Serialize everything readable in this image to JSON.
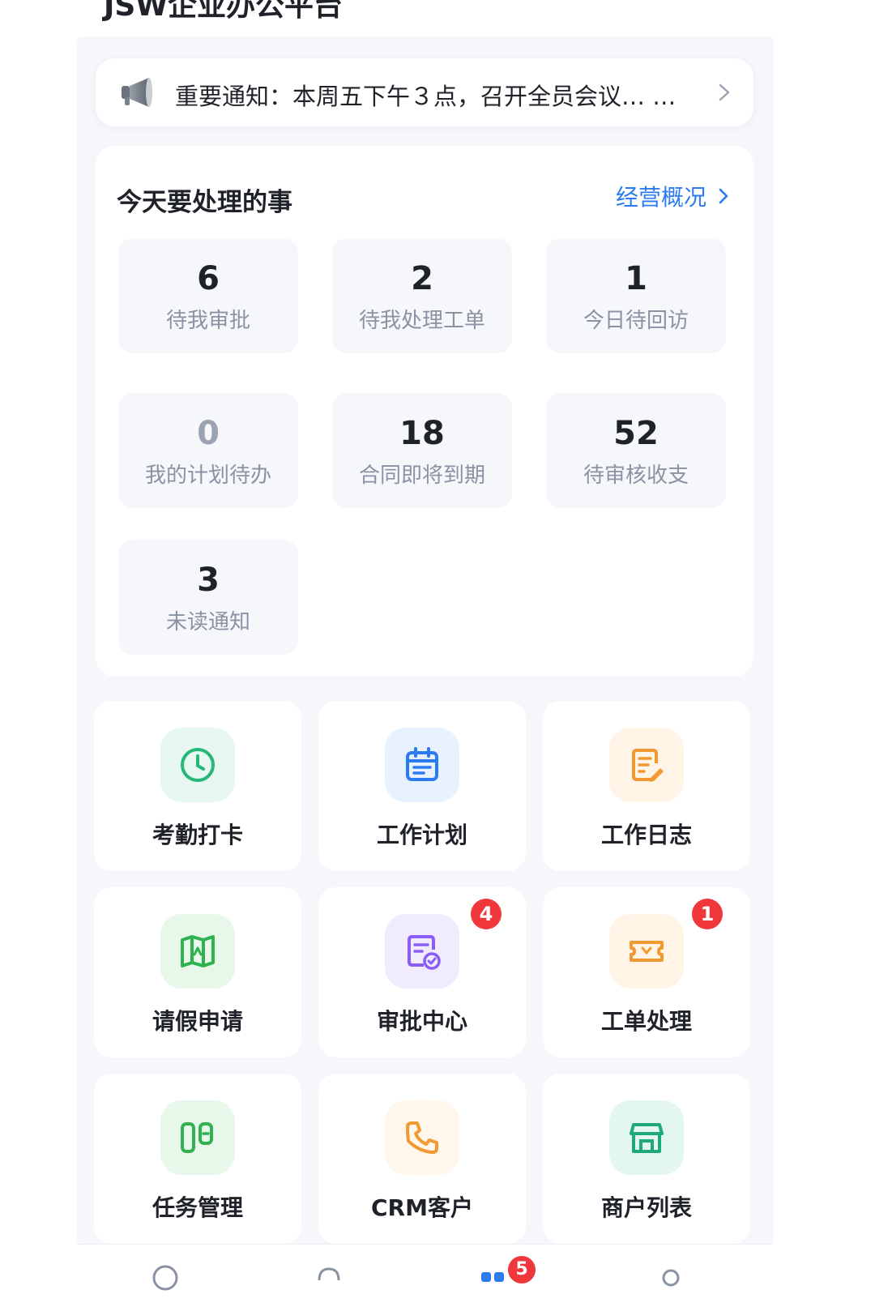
{
  "app": {
    "title": "JSW企业办公平台"
  },
  "notice": {
    "text": "重要通知：本周五下午３点，召开全员会议… …"
  },
  "todo": {
    "title": "今天要处理的事",
    "overview_link": "经营概况",
    "stats": [
      {
        "value": "6",
        "label": "待我审批"
      },
      {
        "value": "2",
        "label": "待我处理工单"
      },
      {
        "value": "1",
        "label": "今日待回访"
      },
      {
        "value": "0",
        "label": "我的计划待办"
      },
      {
        "value": "18",
        "label": "合同即将到期"
      },
      {
        "value": "52",
        "label": "待审核收支"
      },
      {
        "value": "3",
        "label": "未读通知"
      }
    ]
  },
  "apps": [
    {
      "label": "考勤打卡",
      "icon": "clock-icon",
      "color": "#27b779",
      "bg": "#e6f8f1"
    },
    {
      "label": "工作计划",
      "icon": "calendar-icon",
      "color": "#2d7bf3",
      "bg": "#e8f1fe"
    },
    {
      "label": "工作日志",
      "icon": "note-edit-icon",
      "color": "#f29a32",
      "bg": "#fff4e6"
    },
    {
      "label": "请假申请",
      "icon": "map-icon",
      "color": "#2fb24f",
      "bg": "#e7f8ea"
    },
    {
      "label": "审批中心",
      "icon": "approval-icon",
      "color": "#8b5cf6",
      "bg": "#f1ebfe",
      "badge": "4"
    },
    {
      "label": "工单处理",
      "icon": "ticket-icon",
      "color": "#f29a32",
      "bg": "#fff4e6",
      "badge": "1"
    },
    {
      "label": "任务管理",
      "icon": "task-icon",
      "color": "#2fb24f",
      "bg": "#e7f8ea"
    },
    {
      "label": "CRM客户",
      "icon": "phone-icon",
      "color": "#f29a32",
      "bg": "#fff7eb"
    },
    {
      "label": "商户列表",
      "icon": "store-icon",
      "color": "#1ea97c",
      "bg": "#e4f7ef"
    }
  ],
  "bottom_nav": {
    "badge": "5"
  }
}
